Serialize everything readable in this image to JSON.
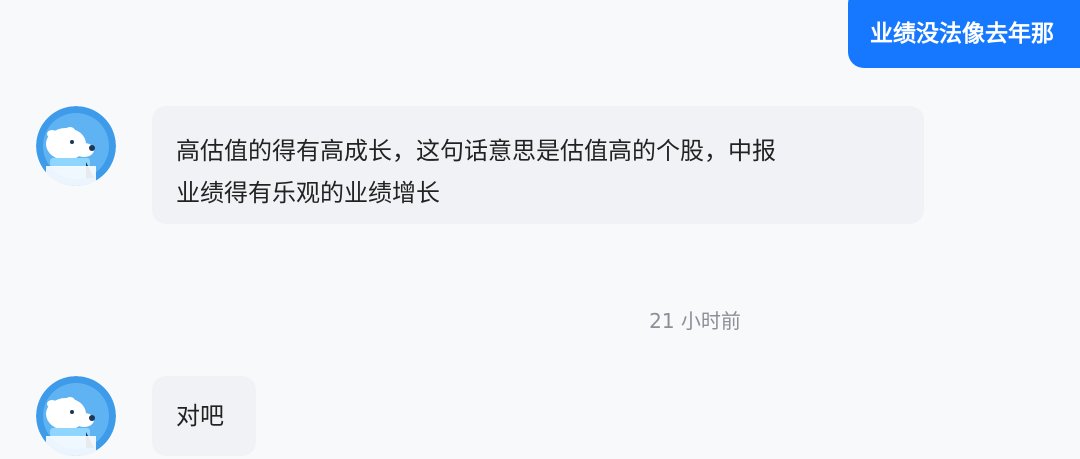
{
  "outgoing": {
    "text": "业绩没法像去年那"
  },
  "messages": [
    {
      "sender": "bot",
      "lines": [
        "高估值的得有高成长，这句话意思是估值高的个股，中报",
        "业绩得有乐观的业绩增长"
      ]
    },
    {
      "sender": "bot",
      "lines": [
        "对吧"
      ]
    }
  ],
  "timestamp": "21 小时前",
  "colors": {
    "outgoing_bubble": "#1677ff",
    "incoming_bubble": "#f1f2f5",
    "avatar_bg": "#3d9be9"
  },
  "avatar_icon": "polar-bear-icon"
}
